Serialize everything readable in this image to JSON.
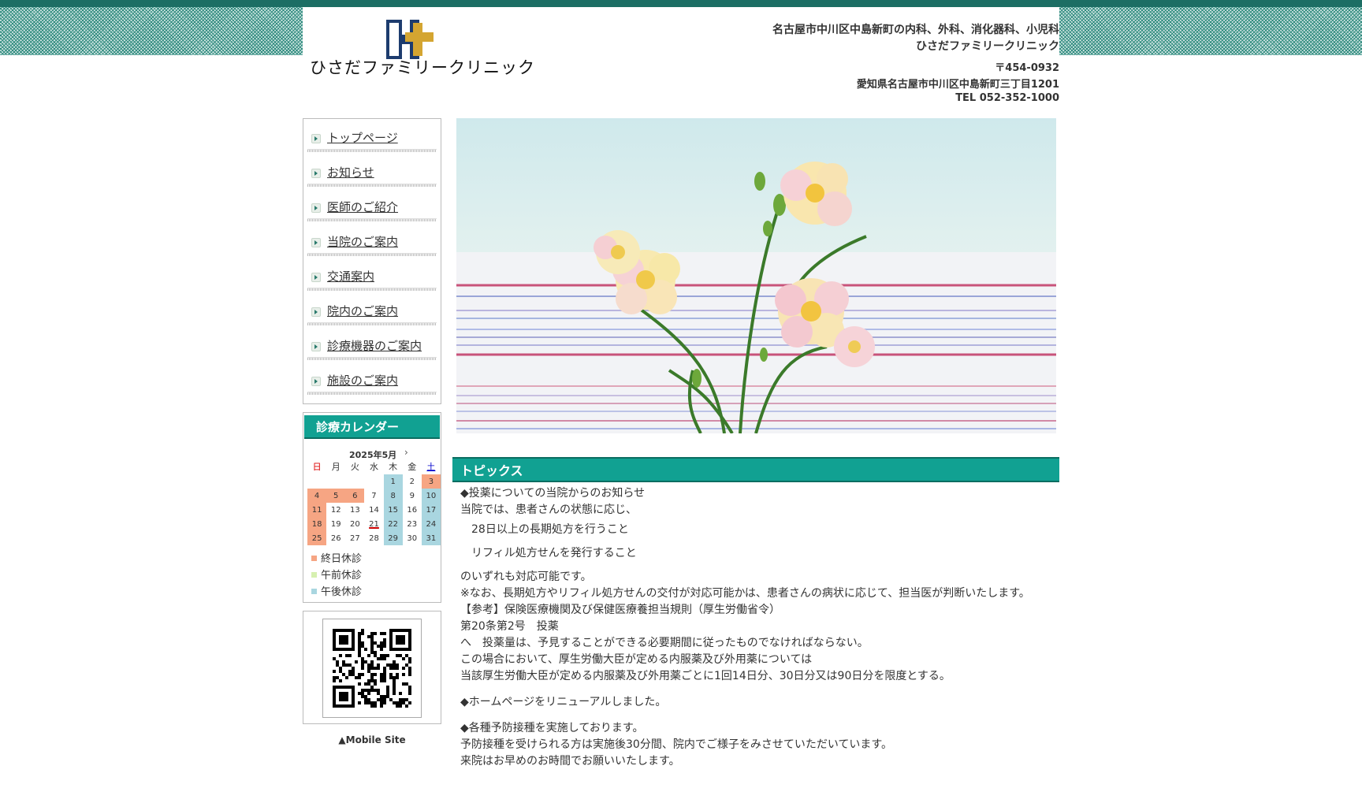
{
  "header": {
    "clinic_name": "ひさだファミリークリニック",
    "tagline": "名古屋市中川区中島新町の内科、外科、消化器科、小児科",
    "tagline_name": "ひさだファミリークリニック",
    "postal": "〒454-0932",
    "address": "愛知県名古屋市中川区中島新町三丁目1201",
    "tel": "TEL 052-352-1000",
    "logo_colors": {
      "navy": "#1d3c6e",
      "gold": "#d4a531"
    }
  },
  "nav": {
    "items": [
      {
        "label": "トップページ"
      },
      {
        "label": "お知らせ"
      },
      {
        "label": "医師のご紹介"
      },
      {
        "label": "当院のご案内"
      },
      {
        "label": "交通案内"
      },
      {
        "label": "院内のご案内"
      },
      {
        "label": "診療機器のご案内"
      },
      {
        "label": "施設のご案内"
      }
    ]
  },
  "calendar": {
    "title": "診療カレンダー",
    "month": "2025年5月",
    "weekdays": [
      "日",
      "月",
      "火",
      "水",
      "木",
      "金",
      "土"
    ],
    "weeks": [
      [
        "",
        "",
        "",
        "",
        "1",
        "2",
        "3"
      ],
      [
        "4",
        "5",
        "6",
        "7",
        "8",
        "9",
        "10"
      ],
      [
        "11",
        "12",
        "13",
        "14",
        "15",
        "16",
        "17"
      ],
      [
        "18",
        "19",
        "20",
        "21",
        "22",
        "23",
        "24"
      ],
      [
        "25",
        "26",
        "27",
        "28",
        "29",
        "30",
        "31"
      ]
    ],
    "legend": {
      "closed": "終日休診",
      "am_closed": "午前休診",
      "pm_closed": "午後休診"
    },
    "colors": {
      "closed": "#f6a583",
      "am_closed": "#d6f0b0",
      "pm_closed": "#a9d6e0"
    }
  },
  "mobile": {
    "label": "▲Mobile Site"
  },
  "topics": {
    "title": "トピックス",
    "lines": {
      "l1": "◆投薬についての当院からのお知らせ",
      "l2": "当院では、患者さんの状態に応じ、",
      "l3": "　28日以上の長期処方を行うこと",
      "l4": "　リフィル処方せんを発行すること",
      "l5": "のいずれも対応可能です。",
      "l6": "※なお、長期処方やリフィル処方せんの交付が対応可能かは、患者さんの病状に応じて、担当医が判断いたします。",
      "l7": "【参考】保険医療機関及び保健医療養担当規則（厚生労働省令）",
      "l8": "第20条第2号　投薬",
      "l9": "へ　投薬量は、予見することができる必要期間に従ったものでなければならない。",
      "l10": "この場合において、厚生労働大臣が定める内服薬及び外用薬については",
      "l11": "当該厚生労働大臣が定める内服薬及び外用薬ごとに1回14日分、30日分又は90日分を限度とする。",
      "l12": "◆ホームページをリニューアルしました。",
      "l13": "◆各種予防接種を実施しております。",
      "l14": "予防接種を受けられる方は実施後30分間、院内でご様子をみさせていただいています。",
      "l15": "来院はお早めのお時間でお願いいたします。"
    }
  },
  "theme": {
    "accent": "#11a192",
    "accent_dark": "#0b6d61",
    "topbar": "#1c6e64"
  }
}
